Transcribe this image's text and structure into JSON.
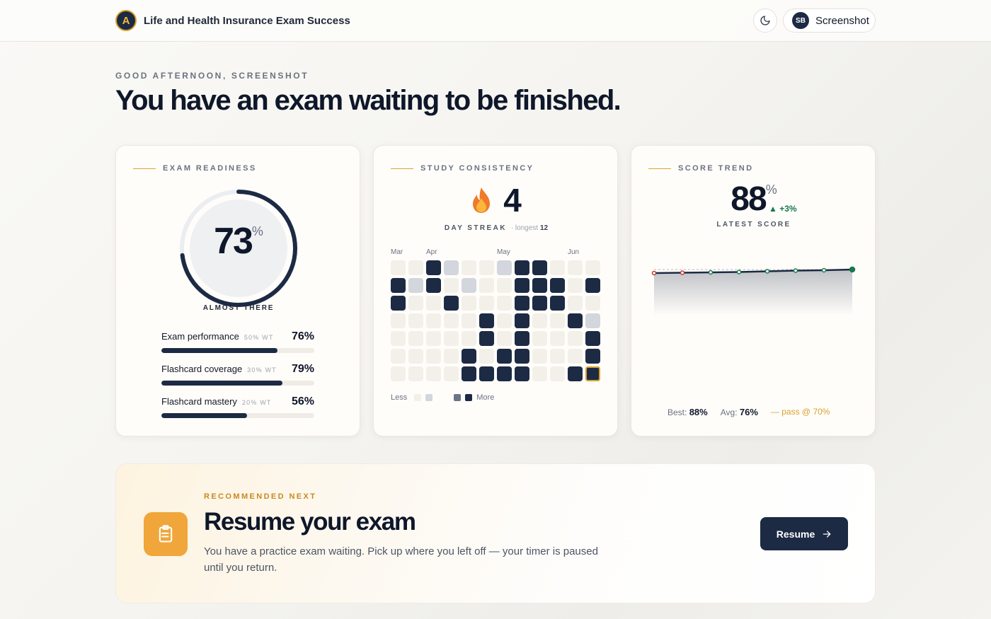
{
  "header": {
    "app_title": "Life and Health Insurance Exam Success",
    "logo_letter": "A",
    "user_initials": "SB",
    "user_name": "Screenshot"
  },
  "greeting": "GOOD AFTERNOON, SCREENSHOT",
  "headline": "You have an exam waiting to be finished.",
  "readiness": {
    "label": "EXAM READINESS",
    "value": "73",
    "unit": "%",
    "fraction": 0.73,
    "status": "ALMOST THERE",
    "metrics": [
      {
        "name": "Exam performance",
        "weight": "50% WT",
        "value": "76%",
        "fraction": 0.76
      },
      {
        "name": "Flashcard coverage",
        "weight": "30% WT",
        "value": "79%",
        "fraction": 0.79
      },
      {
        "name": "Flashcard mastery",
        "weight": "20% WT",
        "value": "56%",
        "fraction": 0.56
      }
    ]
  },
  "consistency": {
    "label": "STUDY CONSISTENCY",
    "streak": "4",
    "streak_label": "DAY STREAK",
    "longest_prefix": "· longest",
    "longest": "12",
    "months": [
      "Mar",
      "Apr",
      "May",
      "Jun"
    ],
    "heatmap": [
      [
        0,
        0,
        3,
        1,
        0,
        0,
        1,
        3,
        3,
        0,
        0,
        0
      ],
      [
        3,
        1,
        3,
        0,
        1,
        0,
        0,
        3,
        3,
        3,
        0,
        3
      ],
      [
        3,
        0,
        0,
        3,
        0,
        0,
        0,
        3,
        3,
        3,
        0,
        0
      ],
      [
        0,
        0,
        0,
        0,
        0,
        3,
        0,
        3,
        0,
        0,
        3,
        1
      ],
      [
        0,
        0,
        0,
        0,
        0,
        3,
        0,
        3,
        0,
        0,
        0,
        3
      ],
      [
        0,
        0,
        0,
        0,
        3,
        0,
        3,
        3,
        0,
        0,
        0,
        3
      ],
      [
        0,
        0,
        0,
        0,
        3,
        3,
        3,
        3,
        0,
        0,
        3,
        3
      ]
    ],
    "legend_less": "Less",
    "legend_more": "More",
    "colors": {
      "empty": "#f3f0ea",
      "low": "#d3d6dc",
      "mid": "#6b7488",
      "high": "#1c2a44"
    }
  },
  "trend": {
    "label": "SCORE TREND",
    "value": "88",
    "unit": "%",
    "delta": "+3%",
    "sub": "LATEST SCORE",
    "scores": [
      70,
      71,
      72,
      73,
      75,
      77,
      78,
      80
    ],
    "pass_mark": 70,
    "best_label": "Best:",
    "best": "88%",
    "avg_label": "Avg:",
    "avg": "76%",
    "pass_label": "— pass @ 70%",
    "colors": {
      "line": "#1c2a44",
      "pass": "#d9a32b",
      "fail_point": "#c0392b",
      "pass_point": "#16794d"
    }
  },
  "recommended": {
    "eyebrow": "RECOMMENDED NEXT",
    "title": "Resume your exam",
    "description": "You have a practice exam waiting. Pick up where you left off — your timer is paused until you return.",
    "button": "Resume",
    "accent": "#f0a63a"
  }
}
